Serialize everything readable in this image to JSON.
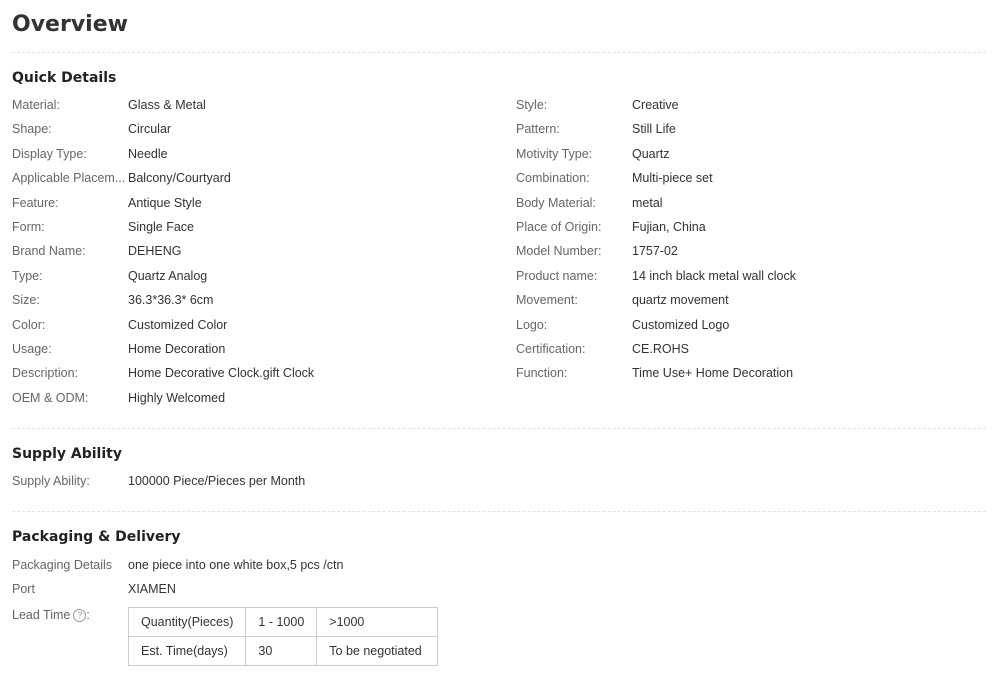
{
  "overview_title": "Overview",
  "quick_details": {
    "title": "Quick Details",
    "left": [
      {
        "k": "Material:",
        "v": "Glass & Metal"
      },
      {
        "k": "Shape:",
        "v": "Circular"
      },
      {
        "k": "Display Type:",
        "v": "Needle"
      },
      {
        "k": "Applicable Placem...",
        "v": "Balcony/Courtyard"
      },
      {
        "k": "Feature:",
        "v": "Antique Style"
      },
      {
        "k": "Form:",
        "v": "Single Face"
      },
      {
        "k": "Brand Name:",
        "v": "DEHENG"
      },
      {
        "k": "Type:",
        "v": "Quartz Analog"
      },
      {
        "k": "Size:",
        "v": "36.3*36.3* 6cm"
      },
      {
        "k": "Color:",
        "v": "Customized Color"
      },
      {
        "k": "Usage:",
        "v": "Home Decoration"
      },
      {
        "k": "Description:",
        "v": "Home Decorative Clock.gift Clock"
      },
      {
        "k": "OEM & ODM:",
        "v": "Highly Welcomed"
      }
    ],
    "right": [
      {
        "k": "Style:",
        "v": "Creative"
      },
      {
        "k": "Pattern:",
        "v": "Still Life"
      },
      {
        "k": "Motivity Type:",
        "v": "Quartz"
      },
      {
        "k": "Combination:",
        "v": "Multi-piece set"
      },
      {
        "k": "Body Material:",
        "v": "metal"
      },
      {
        "k": "Place of Origin:",
        "v": "Fujian, China"
      },
      {
        "k": "Model Number:",
        "v": "1757-02"
      },
      {
        "k": "Product name:",
        "v": "14 inch black metal wall clock"
      },
      {
        "k": "Movement:",
        "v": "quartz movement"
      },
      {
        "k": "Logo:",
        "v": "Customized Logo"
      },
      {
        "k": "Certification:",
        "v": "CE.ROHS"
      },
      {
        "k": "Function:",
        "v": "Time Use+ Home Decoration"
      }
    ]
  },
  "supply": {
    "title": "Supply Ability",
    "k": "Supply Ability:",
    "v": "100000 Piece/Pieces per Month"
  },
  "packaging": {
    "title": "Packaging & Delivery",
    "details_k": "Packaging Details",
    "details_v": "one piece into one white box,5 pcs /ctn",
    "port_k": "Port",
    "port_v": "XIAMEN",
    "lead_k": "Lead Time",
    "lead_help_icon": "question-circle-icon",
    "lead_table": [
      [
        "Quantity(Pieces)",
        "1 - 1000",
        ">1000"
      ],
      [
        "Est. Time(days)",
        "30",
        "To be negotiated"
      ]
    ]
  }
}
